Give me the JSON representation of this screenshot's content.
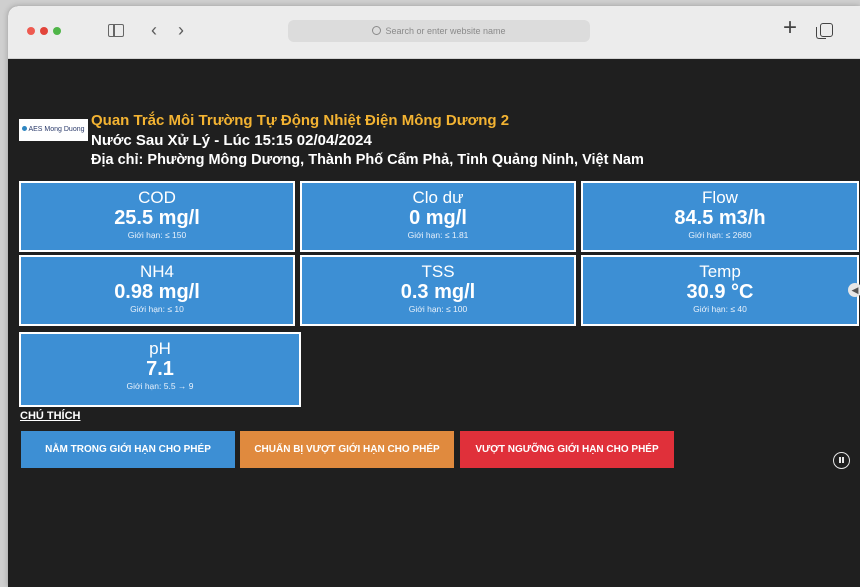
{
  "browser": {
    "search_placeholder": "Search or enter website name"
  },
  "header": {
    "logo_text": "AES Mong Duong",
    "title": "Quan Trắc Môi Trường Tự Động Nhiệt Điện Mông Dương 2",
    "subtitle": "Nước Sau Xử Lý - Lúc 15:15  02/04/2024",
    "address": "Địa chỉ: Phường Mông Dương, Thành Phố Cẩm Phả, Tỉnh Quảng Ninh, Việt Nam"
  },
  "metrics": [
    {
      "name": "COD",
      "value": "25.5 mg/l",
      "limit": "Giới hạn: ≤ 150"
    },
    {
      "name": "Clo dư",
      "value": "0 mg/l",
      "limit": "Giới hạn: ≤ 1.81"
    },
    {
      "name": "Flow",
      "value": "84.5 m3/h",
      "limit": "Giới hạn: ≤ 2680"
    },
    {
      "name": "NH4",
      "value": "0.98 mg/l",
      "limit": "Giới hạn: ≤ 10"
    },
    {
      "name": "TSS",
      "value": "0.3 mg/l",
      "limit": "Giới hạn: ≤ 100"
    },
    {
      "name": "Temp",
      "value": "30.9 °C",
      "limit": "Giới hạn: ≤ 40"
    },
    {
      "name": "pH",
      "value": "7.1",
      "limit": "Giới hạn: 5.5 → 9"
    }
  ],
  "legend": {
    "title": "CHÚ THÍCH",
    "items": [
      {
        "label": "NẰM TRONG GIỚI HẠN CHO PHÉP",
        "color": "#3d8fd4"
      },
      {
        "label": "CHUẨN BỊ VƯỢT GIỚI HẠN CHO PHÉP",
        "color": "#e08a3e"
      },
      {
        "label": "VƯỢT NGƯỠNG GIỚI HẠN CHO PHÉP",
        "color": "#e0303a"
      }
    ]
  }
}
